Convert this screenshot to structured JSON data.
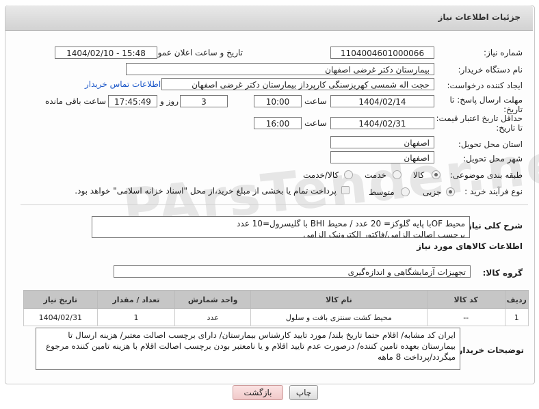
{
  "header": {
    "title": "جزئیات اطلاعات نیاز"
  },
  "fields": {
    "need_number_label": "شماره نیاز:",
    "need_number": "1104004601000066",
    "announce_label": "تاریخ و ساعت اعلان عمومی:",
    "announce_value": "1404/02/10 - 15:48",
    "buyer_org_label": "نام دستگاه خریدار:",
    "buyer_org": "بیمارستان دکتر غرضی اصفهان",
    "requester_label": "ایجاد کننده درخواست:",
    "requester": "حجت اله شمسی کهریزسنگی کارپرداز بیمارستان دکتر غرضی اصفهان",
    "contact_link": "اطلاعات تماس خریدار",
    "deadline_label_1": "مهلت ارسال پاسخ: تا",
    "deadline_label_2": "تاریخ:",
    "deadline_date": "1404/02/14",
    "time_label": "ساعت",
    "deadline_time": "10:00",
    "days_value": "3",
    "days_label": "روز و",
    "remaining_time": "17:45:49",
    "remaining_label": "ساعت باقی مانده",
    "price_validity_label_1": "حداقل تاریخ اعتبار قیمت:",
    "price_validity_label_2": "تا تاریخ:",
    "price_validity_date": "1404/02/31",
    "price_validity_time": "16:00",
    "province_label": "استان محل تحویل:",
    "province": "اصفهان",
    "city_label": "شهر محل تحویل:",
    "city": "اصفهان",
    "category_label": "طبقه بندی موضوعی:",
    "category_options": [
      "کالا",
      "خدمت",
      "کالا/خدمت"
    ],
    "process_label": "نوع فرآیند خرید :",
    "process_options": [
      "جزیی",
      "متوسط"
    ],
    "payment_note": "پرداخت تمام یا بخشی از مبلغ خرید،از محل \"اسناد خزانه اسلامی\" خواهد بود.",
    "summary_label": "شرح کلی نیاز:",
    "summary_line1": "محیط OFبا پایه گلوکز= 20 عدد / محیط BHI با گلیسرول=10 عدد",
    "summary_line2": "برچسب اصالت الزامی/فاکتور الکترونیک الزامی"
  },
  "goods_section": {
    "title": "اطلاعات کالاهای مورد نیاز",
    "group_label": "گروه کالا:",
    "group_value": "تجهیزات آزمایشگاهی و اندازه‌گیری"
  },
  "table": {
    "headers": [
      "ردیف",
      "کد کالا",
      "نام کالا",
      "واحد شمارش",
      "تعداد / مقدار",
      "تاریخ نیاز"
    ],
    "rows": [
      [
        "1",
        "--",
        "محیط کشت سنتزی بافت و سلول",
        "عدد",
        "1",
        "1404/02/31"
      ]
    ]
  },
  "buyer_notes": {
    "label": "توضیحات خریدار:",
    "text": "ایران کد مشابه/ اقلام حتما تاریخ بلند/ مورد تایید کارشناس بیمارستان/ دارای برچسب اصالت معتبر/ هزینه ارسال تا بیمارستان بعهده تامین کننده/ درصورت عدم تایید اقلام و یا نامعتبر بودن برچسب اصالت اقلام با هزینه تامین کننده مرجوع میگردد/پرداخت 8 ماهه"
  },
  "buttons": {
    "print": "چاپ",
    "back": "بازگشت"
  },
  "watermark": "PArsTender.net"
}
